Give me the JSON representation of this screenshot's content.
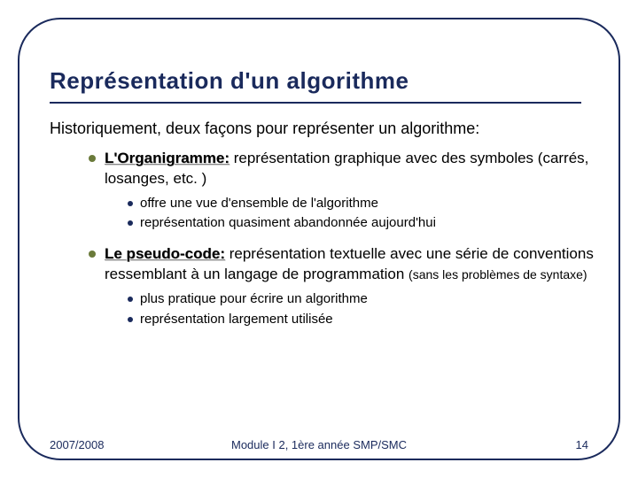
{
  "title": "Représentation d'un algorithme",
  "intro": "Historiquement, deux façons pour représenter un algorithme:",
  "items": [
    {
      "term": "L'Organigramme:",
      "desc": " représentation graphique avec des symboles (carrés, losanges, etc. )",
      "subs": [
        "offre une vue d'ensemble de l'algorithme",
        "représentation quasiment abandonnée aujourd'hui"
      ]
    },
    {
      "term": "Le pseudo-code:",
      "desc": " représentation textuelle avec une série de conventions ressemblant à un langage de programmation ",
      "desc_small": "(sans les problèmes de syntaxe)",
      "subs": [
        "plus pratique pour écrire un algorithme",
        "représentation largement utilisée"
      ]
    }
  ],
  "footer": {
    "left": "2007/2008",
    "center": "Module I 2, 1ère année SMP/SMC",
    "right": "14"
  }
}
